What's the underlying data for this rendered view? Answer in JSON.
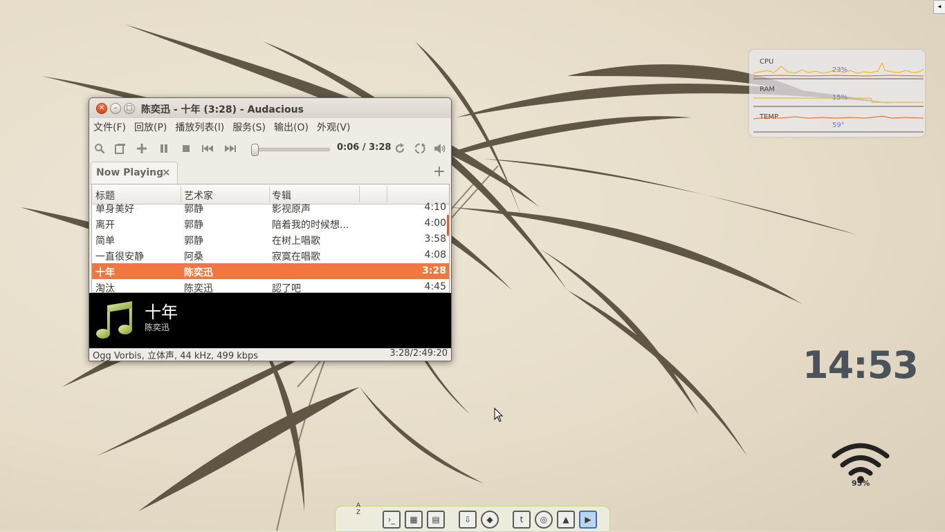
{
  "window": {
    "title": "陈奕迅 - 十年 (3:28) - Audacious",
    "close_glyph": "✕",
    "minimize_glyph": "–",
    "maximize_glyph": "□"
  },
  "menubar": {
    "items": [
      "文件(F)",
      "回放(P)",
      "播放列表(l)",
      "服务(S)",
      "输出(O)",
      "外观(V)"
    ]
  },
  "toolbar": {
    "time": "0:06 / 3:28",
    "progress": 0.03,
    "icons": [
      "search-icon",
      "open-files-icon",
      "add-files-icon",
      "pause-icon",
      "stop-icon",
      "previous-icon",
      "next-icon",
      "repeat-icon",
      "shuffle-icon",
      "volume-icon"
    ]
  },
  "tabs": [
    {
      "label": "Now Playing",
      "close_glyph": "✕"
    }
  ],
  "add_tab_glyph": "+",
  "playlist": {
    "columns": [
      "标题",
      "艺术家",
      "专辑",
      "",
      ""
    ],
    "rows": [
      {
        "title": "单身美好",
        "artist": "郭静",
        "album": "影视原声",
        "length": "4:10",
        "selected": false
      },
      {
        "title": "离开",
        "artist": "郭静",
        "album": "陪着我的时候想...",
        "length": "4:00",
        "selected": false
      },
      {
        "title": "简单",
        "artist": "郭静",
        "album": "在树上唱歌",
        "length": "3:58",
        "selected": false
      },
      {
        "title": "一直很安静",
        "artist": "阿桑",
        "album": "寂寞在唱歌",
        "length": "4:08",
        "selected": false
      },
      {
        "title": "十年",
        "artist": "陈奕迅",
        "album": "",
        "length": "3:28",
        "selected": true
      },
      {
        "title": "淘汰",
        "artist": "陈奕迅",
        "album": "認了吧",
        "length": "4:45",
        "selected": false
      }
    ]
  },
  "now_playing": {
    "title": "十年",
    "artist": "陈奕迅"
  },
  "statusbar": {
    "format": "Ogg Vorbis, 立体声, 44 kHz, 499 kbps",
    "total": "3:28/2:49:20"
  },
  "sysmon": {
    "cpu_label": "CPU",
    "cpu_value": "23%",
    "ram_label": "RAM",
    "ram_value": "15%",
    "temp_label": "TEMP",
    "temp_value": "59°"
  },
  "clock": "14:53",
  "wifi": {
    "signal": "95%"
  },
  "dock": {
    "az_label": "A Z",
    "items": [
      "terminal-icon",
      "calculator-icon",
      "file-manager-icon",
      "download-icon",
      "package-icon",
      "twitter-icon",
      "chrome-icon",
      "upload-icon",
      "media-player-icon"
    ]
  },
  "corner_glyph": "◂",
  "colors": {
    "selection": "#f0773e",
    "accent_close": "#e2511f",
    "monitor_value": "#6c6cf0",
    "clock": "#4a5359"
  }
}
